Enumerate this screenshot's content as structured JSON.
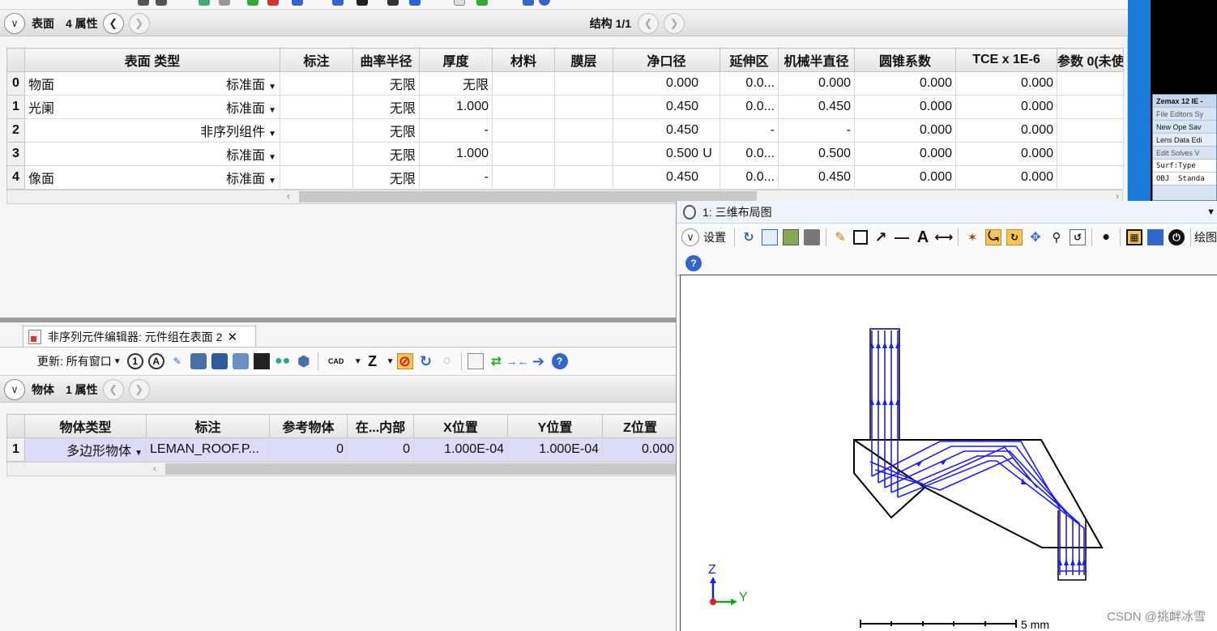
{
  "lde": {
    "bar": {
      "label": "表面",
      "props": "4 属性",
      "config": "结构 1/1"
    },
    "columns": [
      "表面 类型",
      "标注",
      "曲率半径",
      "厚度",
      "材料",
      "膜层",
      "净口径",
      "延伸区",
      "机械半直径",
      "圆锥系数",
      "TCE x 1E-6",
      "参数 0(未使"
    ],
    "rows": [
      {
        "n": "0",
        "name": "物面",
        "type": "标准面",
        "radius": "无限",
        "thickness": "无限",
        "semi": "0.000",
        "flag": "",
        "ext": "0.0...",
        "mech": "0.000",
        "conic": "0.000",
        "tce": "0.000"
      },
      {
        "n": "1",
        "name": "光阑",
        "type": "标准面",
        "radius": "无限",
        "thickness": "1.000",
        "semi": "0.450",
        "flag": "",
        "ext": "0.0...",
        "mech": "0.450",
        "conic": "0.000",
        "tce": "0.000"
      },
      {
        "n": "2",
        "name": "",
        "type": "非序列组件",
        "radius": "无限",
        "thickness": "-",
        "semi": "0.450",
        "flag": "",
        "ext": "-",
        "mech": "-",
        "conic": "0.000",
        "tce": "0.000"
      },
      {
        "n": "3",
        "name": "",
        "type": "标准面",
        "radius": "无限",
        "thickness": "1.000",
        "semi": "0.500",
        "flag": "U",
        "ext": "0.0...",
        "mech": "0.500",
        "conic": "0.000",
        "tce": "0.000"
      },
      {
        "n": "4",
        "name": "像面",
        "type": "标准面",
        "radius": "无限",
        "thickness": "-",
        "semi": "0.450",
        "flag": "",
        "ext": "0.0...",
        "mech": "0.450",
        "conic": "0.000",
        "tce": "0.000"
      }
    ]
  },
  "nsc": {
    "tab_title": "非序列元件编辑器: 元件组在表面 2",
    "update_label": "更新: 所有窗口",
    "bar": {
      "label": "物体",
      "props": "1 属性"
    },
    "columns": [
      "物体类型",
      "标注",
      "参考物体",
      "在...内部",
      "X位置",
      "Y位置",
      "Z位置"
    ],
    "rows": [
      {
        "n": "1",
        "type": "多边形物体",
        "comment": "LEMAN_ROOF.P...",
        "ref": "0",
        "inside": "0",
        "x": "1.000E-04",
        "y": "1.000E-04",
        "z": "0.000"
      }
    ]
  },
  "layout3d": {
    "title": "1: 三维布局图",
    "settings_label": "设置",
    "draw_label": "绘图",
    "scale_label": "5 mm",
    "axis_z": "Z",
    "axis_y": "Y"
  },
  "zemax_mini": {
    "title": "Zemax 12 IE -",
    "menu": "File  Editors  Sy",
    "buttons": "New  Ope  Sav",
    "lde_title": "Lens Data Edi",
    "lde_menu": "Edit  Solves  V",
    "header": "Surf:Type",
    "row_obj": "OBJ",
    "row_obj_val": "Standa"
  },
  "watermark": "CSDN @挑衅冰雪",
  "colors": {
    "ray": "#1f1fe6",
    "outline": "#000000",
    "accent": "#1a7ad8"
  }
}
